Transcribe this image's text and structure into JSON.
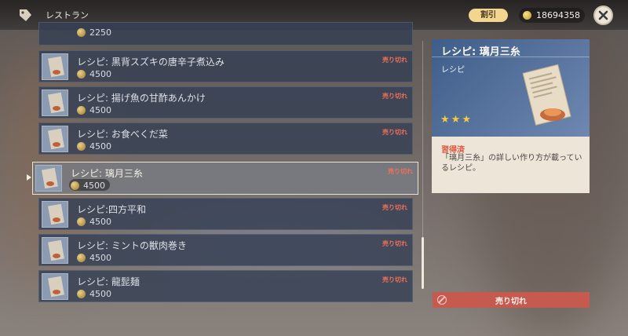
{
  "header": {
    "shop_title": "レストラン",
    "discount_label": "割引",
    "mora": "18694358"
  },
  "list": [
    {
      "name": "",
      "price": "2250",
      "sold_out": ""
    },
    {
      "name": "レシピ: 黒背スズキの唐辛子煮込み",
      "price": "4500",
      "sold_out": "売り切れ"
    },
    {
      "name": "レシピ: 揚げ魚の甘酢あんかけ",
      "price": "4500",
      "sold_out": "売り切れ"
    },
    {
      "name": "レシピ: お食べくだ菜",
      "price": "4500",
      "sold_out": "売り切れ"
    },
    {
      "name": "レシピ: 璃月三糸",
      "price": "4500",
      "sold_out": "売り切れ"
    },
    {
      "name": "レシピ:四方平和",
      "price": "4500",
      "sold_out": "売り切れ"
    },
    {
      "name": "レシピ: ミントの獣肉巻き",
      "price": "4500",
      "sold_out": "売り切れ"
    },
    {
      "name": "レシピ: 龍髭麺",
      "price": "4500",
      "sold_out": "売り切れ"
    }
  ],
  "detail": {
    "title": "レシピ: 璃月三糸",
    "type": "レシピ",
    "stars": 3,
    "status": "習得済",
    "description": "「璃月三糸」の詳しい作り方が載っているレシピ。"
  },
  "action": {
    "sold_out_label": "売り切れ"
  },
  "colors": {
    "accent_gold": "#f2d690",
    "sold_out_red": "#e0563f",
    "card_blue": "#3e5d89",
    "button_red": "#c75a4f"
  },
  "icons": [
    "shop-tag-icon",
    "mora-coin-icon",
    "close-icon",
    "recipe-icon",
    "star-icon",
    "ban-icon"
  ]
}
